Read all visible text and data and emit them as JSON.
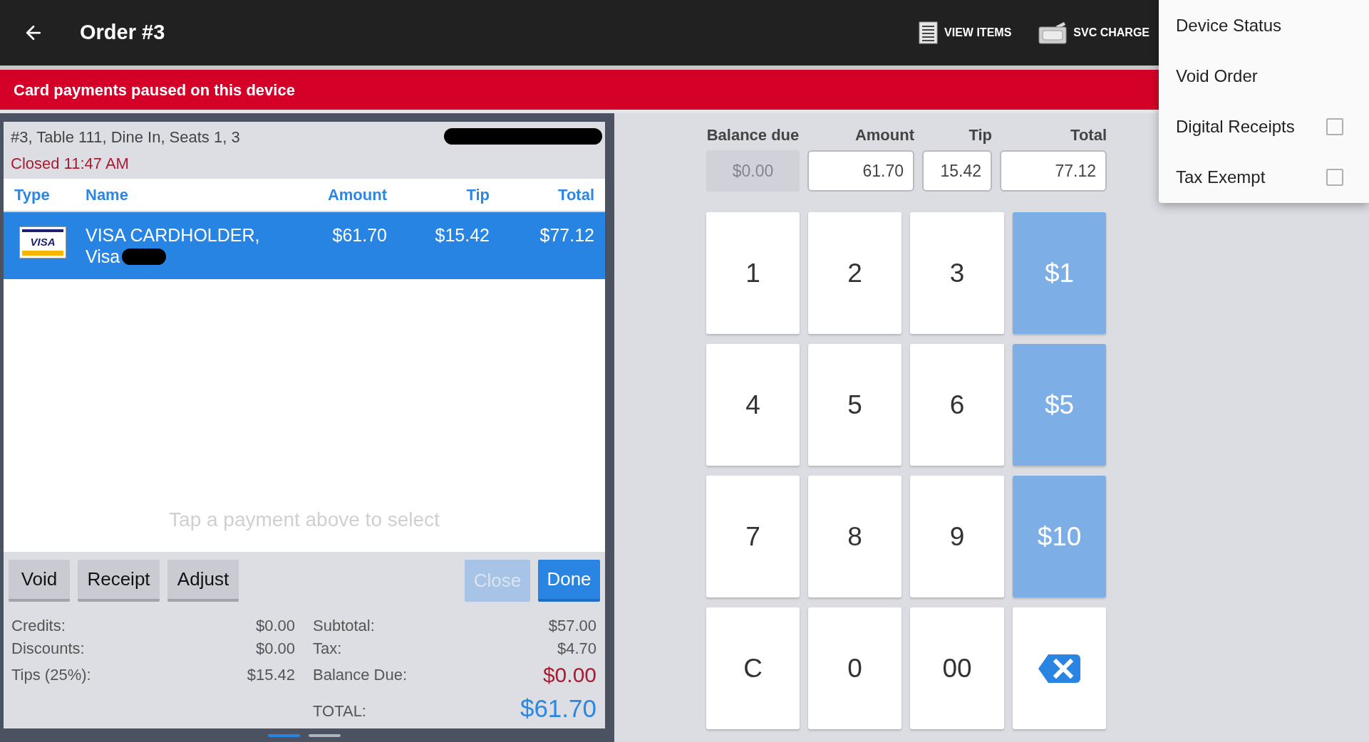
{
  "app_bar": {
    "title": "Order #3",
    "actions": [
      {
        "label": "VIEW ITEMS",
        "kind": "list"
      },
      {
        "label": "SVC CHARGE",
        "kind": "charge"
      }
    ]
  },
  "banner": {
    "text": "Card payments paused on this device"
  },
  "order_panel": {
    "info": "#3, Table 111, Dine In, Seats 1, 3",
    "status": "Closed 11:47 AM",
    "payments": {
      "columns": [
        "Type",
        "Name",
        "Amount",
        "Tip",
        "Total"
      ],
      "rows": [
        {
          "card_logo": "VISA",
          "cardholder": "VISA CARDHOLDER,",
          "card": "Visa",
          "amount": "$61.70",
          "tip": "$15.42",
          "total": "$77.12",
          "selected": true
        }
      ]
    },
    "hint": "Tap a payment above to select",
    "buttons": [
      {
        "label": "Void",
        "kind": "secondary",
        "disabled": false
      },
      {
        "label": "Receipt",
        "kind": "secondary",
        "disabled": false
      },
      {
        "label": "Adjust",
        "kind": "secondary",
        "disabled": false
      },
      {
        "label": "Close",
        "kind": "primary",
        "disabled": true
      },
      {
        "label": "Done",
        "kind": "primary",
        "disabled": false
      }
    ],
    "summary_left": [
      {
        "label": "Credits:",
        "value": "$0.00"
      },
      {
        "label": "Discounts:",
        "value": "$0.00"
      },
      {
        "label": "Tips (25%):",
        "value": "$15.42"
      }
    ],
    "summary_right": [
      {
        "label": "Subtotal:",
        "value": "$57.00",
        "kind": "plain"
      },
      {
        "label": "Tax:",
        "value": "$4.70",
        "kind": "plain"
      },
      {
        "label": "Balance Due:",
        "value": "$0.00",
        "kind": "due"
      },
      {
        "label": "TOTAL:",
        "value": "$61.70",
        "kind": "total"
      }
    ],
    "pages": [
      {
        "selected": true
      },
      {
        "selected": false
      }
    ]
  },
  "payment_entry": {
    "fields": [
      {
        "label": "Balance due",
        "value": "$0.00",
        "disabled": true
      },
      {
        "label": "Amount",
        "value": "61.70",
        "disabled": false
      },
      {
        "label": "Tip",
        "value": "15.42",
        "disabled": false
      },
      {
        "label": "Total",
        "value": "77.12",
        "disabled": false
      }
    ],
    "keys": [
      {
        "label": "1",
        "kind": "digit"
      },
      {
        "label": "2",
        "kind": "digit"
      },
      {
        "label": "3",
        "kind": "digit"
      },
      {
        "label": "$1",
        "kind": "quick"
      },
      {
        "label": "4",
        "kind": "digit"
      },
      {
        "label": "5",
        "kind": "digit"
      },
      {
        "label": "6",
        "kind": "digit"
      },
      {
        "label": "$5",
        "kind": "quick"
      },
      {
        "label": "7",
        "kind": "digit"
      },
      {
        "label": "8",
        "kind": "digit"
      },
      {
        "label": "9",
        "kind": "digit"
      },
      {
        "label": "$10",
        "kind": "quick"
      },
      {
        "label": "C",
        "kind": "digit"
      },
      {
        "label": "0",
        "kind": "digit"
      },
      {
        "label": "00",
        "kind": "digit"
      },
      {
        "kind": "backspace"
      }
    ]
  },
  "overflow_menu": {
    "items": [
      {
        "label": "Device Status",
        "kind": "action"
      },
      {
        "label": "Void Order",
        "kind": "action"
      },
      {
        "label": "Digital Receipts",
        "kind": "toggle",
        "checked": false
      },
      {
        "label": "Tax Exempt",
        "kind": "toggle",
        "checked": false
      }
    ]
  }
}
